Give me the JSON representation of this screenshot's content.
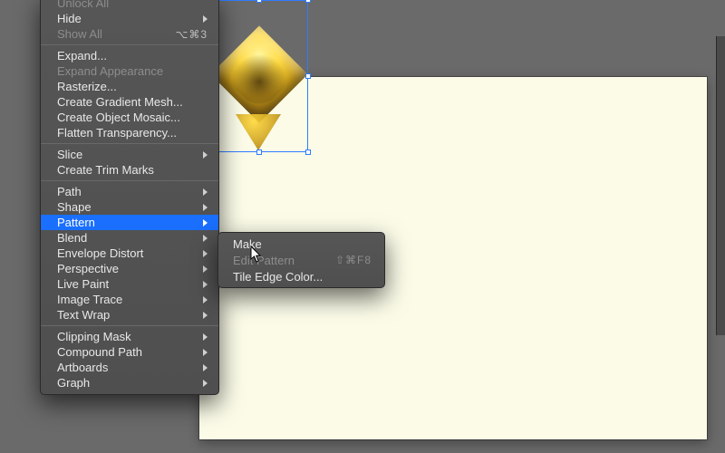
{
  "menu": {
    "section0": [
      {
        "label": "Unlock All",
        "disabled": true
      },
      {
        "label": "Hide",
        "submenu": true
      },
      {
        "label": "Show All",
        "disabled": true,
        "shortcut": "⌥⌘3"
      }
    ],
    "section1": [
      {
        "label": "Expand..."
      },
      {
        "label": "Expand Appearance",
        "disabled": true
      },
      {
        "label": "Rasterize..."
      },
      {
        "label": "Create Gradient Mesh..."
      },
      {
        "label": "Create Object Mosaic..."
      },
      {
        "label": "Flatten Transparency..."
      }
    ],
    "section2": [
      {
        "label": "Slice",
        "submenu": true
      },
      {
        "label": "Create Trim Marks"
      }
    ],
    "section3": [
      {
        "label": "Path",
        "submenu": true
      },
      {
        "label": "Shape",
        "submenu": true
      },
      {
        "label": "Pattern",
        "submenu": true,
        "highlight": true
      },
      {
        "label": "Blend",
        "submenu": true
      },
      {
        "label": "Envelope Distort",
        "submenu": true
      },
      {
        "label": "Perspective",
        "submenu": true
      },
      {
        "label": "Live Paint",
        "submenu": true
      },
      {
        "label": "Image Trace",
        "submenu": true
      },
      {
        "label": "Text Wrap",
        "submenu": true
      }
    ],
    "section4": [
      {
        "label": "Clipping Mask",
        "submenu": true
      },
      {
        "label": "Compound Path",
        "submenu": true
      },
      {
        "label": "Artboards",
        "submenu": true
      },
      {
        "label": "Graph",
        "submenu": true
      }
    ]
  },
  "submenu": {
    "items": [
      {
        "label": "Make"
      },
      {
        "label": "Edit Pattern",
        "shortcut": "⇧⌘F8",
        "disabled": true
      },
      {
        "label": "Tile Edge Color..."
      }
    ]
  }
}
